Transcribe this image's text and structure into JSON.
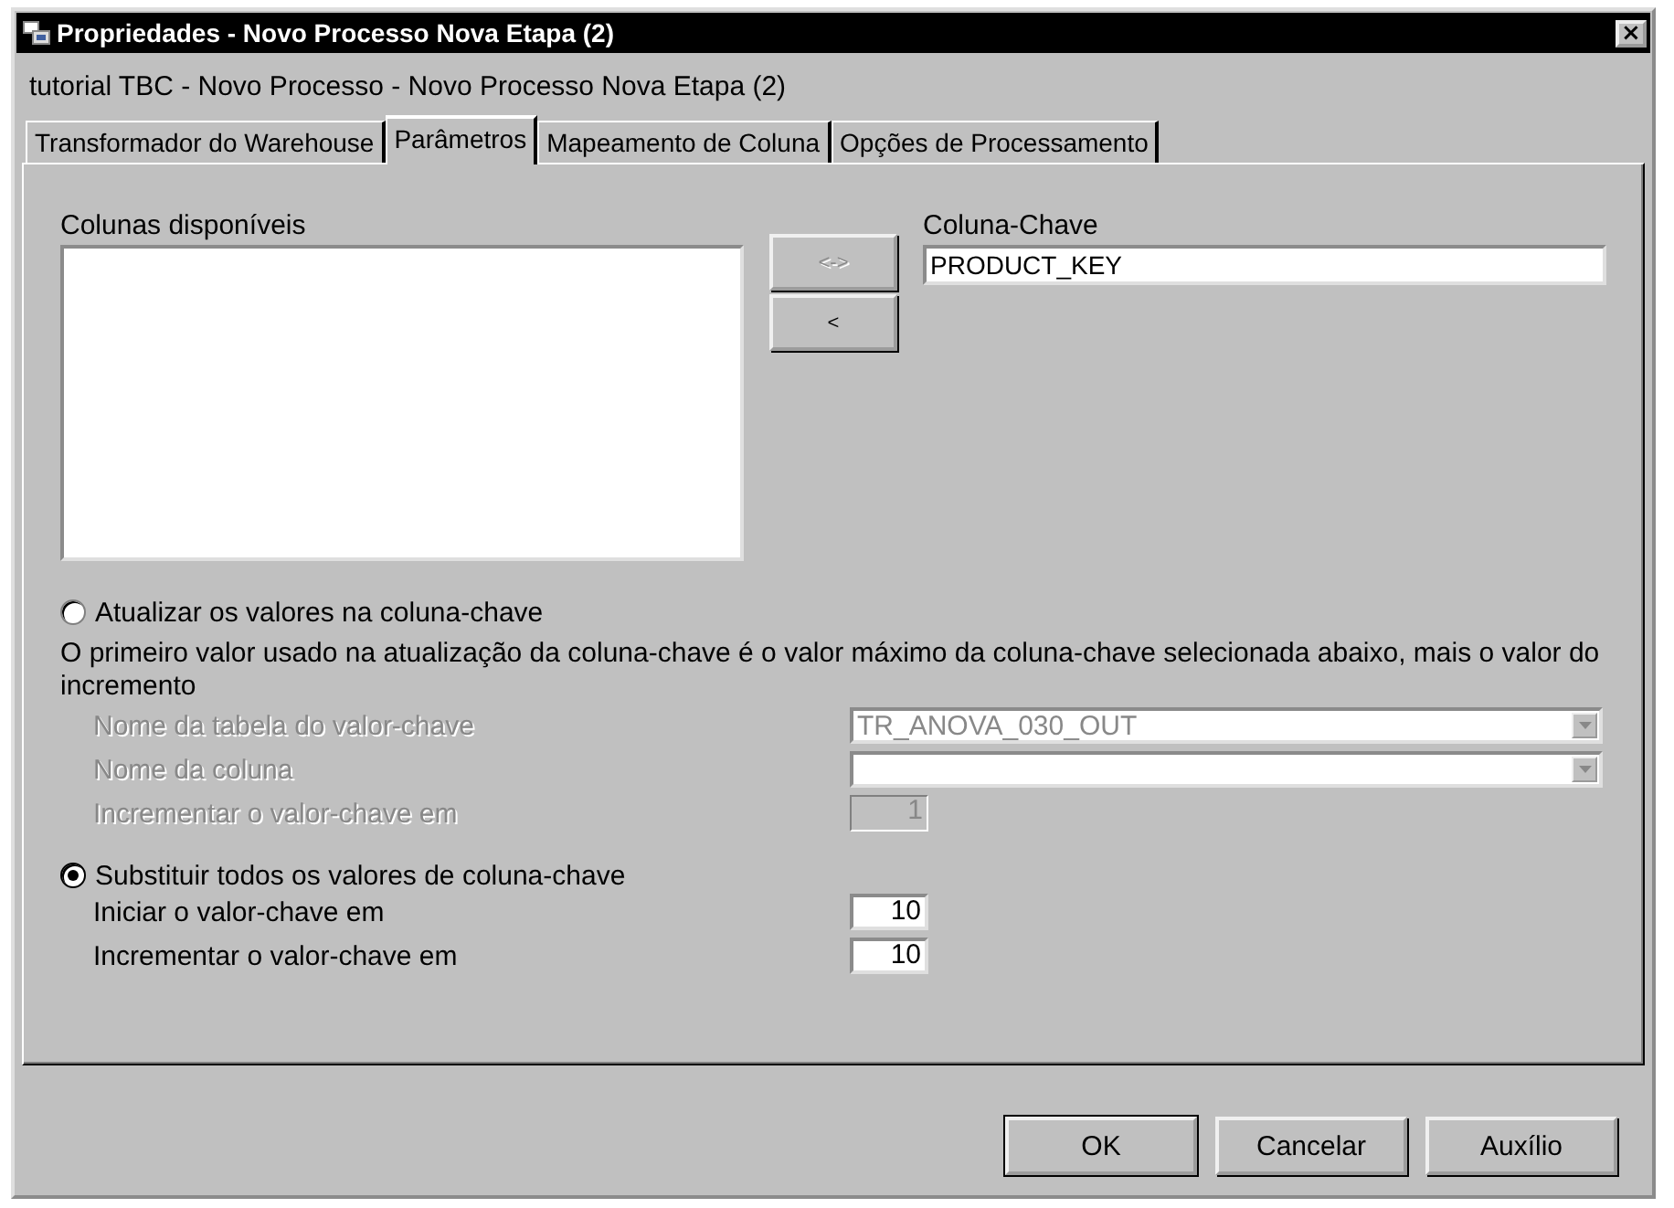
{
  "window": {
    "title": "Propriedades - Novo Processo Nova Etapa (2)",
    "close": "×"
  },
  "subtitle": "tutorial TBC - Novo Processo - Novo Processo Nova Etapa (2)",
  "tabs": [
    {
      "label": "Transformador do Warehouse",
      "selected": false
    },
    {
      "label": "Parâmetros",
      "selected": true
    },
    {
      "label": "Mapeamento de Coluna",
      "selected": false
    },
    {
      "label": "Opções de Processamento",
      "selected": false
    }
  ],
  "available_columns": {
    "label": "Colunas disponíveis"
  },
  "move_buttons": [
    {
      "label": "<->",
      "disabled": true
    },
    {
      "label": "<",
      "disabled": false
    }
  ],
  "key_column": {
    "label": "Coluna-Chave",
    "value": "PRODUCT_KEY"
  },
  "options": [
    {
      "label": "Atualizar os valores na coluna-chave",
      "selected": false,
      "description": "O primeiro valor usado na atualização da coluna-chave é o valor máximo da coluna-chave selecionada abaixo, mais o valor do incremento",
      "fields": [
        {
          "label": "Nome da tabela do valor-chave",
          "kind": "dropdown",
          "value": "TR_ANOVA_030_OUT",
          "disabled": true
        },
        {
          "label": "Nome da coluna",
          "kind": "dropdown",
          "disabled": true
        },
        {
          "label": "Incrementar o valor-chave em",
          "kind": "number",
          "value": "1",
          "disabled": true
        }
      ]
    },
    {
      "label": "Substituir todos os valores de coluna-chave",
      "selected": true,
      "fields": [
        {
          "label": "Iniciar o valor-chave em",
          "kind": "number",
          "value": "10",
          "disabled": false
        },
        {
          "label": "Incrementar o valor-chave em",
          "kind": "number",
          "value": "10",
          "disabled": false
        }
      ]
    }
  ],
  "buttons": [
    {
      "label": "OK",
      "default": true
    },
    {
      "label": "Cancelar",
      "default": false
    },
    {
      "label": "Auxílio",
      "default": false
    }
  ]
}
